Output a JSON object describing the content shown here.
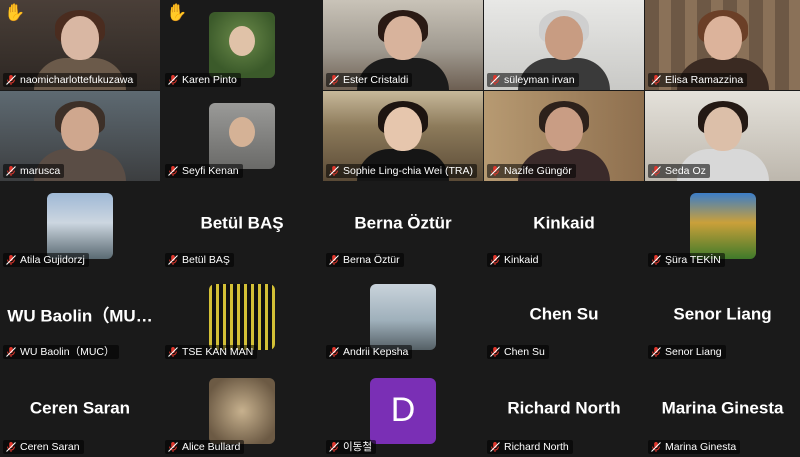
{
  "meeting": {
    "colors": {
      "background": "#1a1a1a",
      "active_speaker": "#2fd36a",
      "muted_icon": "#e0362c"
    },
    "participants": [
      {
        "name": "naomicharlottefukuzawa",
        "hand_raised": true,
        "muted": true,
        "kind": "video",
        "scene": "room-dark",
        "skin": "#d9b7a3",
        "hair": "#4a2c1f",
        "shirt": "#6b5a4a"
      },
      {
        "name": "Karen Pinto",
        "hand_raised": true,
        "muted": true,
        "kind": "photo",
        "scene": "green",
        "skin": "#e0c2a8",
        "hair": "#b89a6a",
        "shirt": "#2c3b4d"
      },
      {
        "name": "Ester Cristaldi",
        "muted": true,
        "kind": "video",
        "scene": "bright-room",
        "skin": "#d8b39c",
        "hair": "#2a1a14",
        "shirt": "#1b1b1b"
      },
      {
        "name": "süleyman irvan",
        "muted": true,
        "kind": "video",
        "scene": "white-wall",
        "skin": "#c89c82",
        "hair": "#cfcfcf",
        "shirt": "#3a3a3a"
      },
      {
        "name": "Elisa Ramazzina",
        "muted": true,
        "kind": "video",
        "scene": "bookshelf",
        "skin": "#dcb39b",
        "hair": "#6b3f27",
        "shirt": "#3a2a22"
      },
      {
        "name": "marusca",
        "muted": true,
        "kind": "video",
        "scene": "room-blue",
        "skin": "#cfa78e",
        "hair": "#3d3028",
        "shirt": "#5a4d45"
      },
      {
        "name": "Seyfi Kenan",
        "muted": true,
        "kind": "photo",
        "scene": "gray",
        "skin": "#d5b296",
        "hair": "#6a4a30",
        "shirt": "#1f2430"
      },
      {
        "name": "Sophie Ling-chia Wei (TRA)",
        "muted": true,
        "active": true,
        "kind": "video",
        "scene": "church",
        "skin": "#e6c6ad",
        "hair": "#1d1410",
        "shirt": "#151515"
      },
      {
        "name": "Nazife Güngör",
        "muted": true,
        "kind": "video",
        "scene": "office-flag",
        "skin": "#c99d84",
        "hair": "#2d211b",
        "shirt": "#3a2a2a"
      },
      {
        "name": "Seda Oz",
        "muted": true,
        "kind": "video",
        "scene": "light-wall",
        "skin": "#dcbfa9",
        "hair": "#241914",
        "shirt": "#d8d8d8"
      },
      {
        "name": "Atila Gujidorzj",
        "muted": true,
        "kind": "photo",
        "scene": "mountain"
      },
      {
        "name": "Betül BAŞ",
        "muted": true,
        "kind": "name"
      },
      {
        "name": "Berna Öztür",
        "muted": true,
        "kind": "name"
      },
      {
        "name": "Kinkaid",
        "muted": true,
        "kind": "name"
      },
      {
        "name": "Şüra TEKİN",
        "muted": true,
        "kind": "photo",
        "scene": "forest"
      },
      {
        "name": "WU Baolin（MU…",
        "label": "WU Baolin（MUC）",
        "muted": true,
        "kind": "name"
      },
      {
        "name": "TSE KAN MAN",
        "muted": true,
        "kind": "photo",
        "scene": "yellow-text"
      },
      {
        "name": "Andrii Kepsha",
        "muted": true,
        "kind": "photo",
        "scene": "harbor"
      },
      {
        "name": "Chen Su",
        "muted": true,
        "kind": "name"
      },
      {
        "name": "Senor Liang",
        "muted": true,
        "kind": "name"
      },
      {
        "name": "Ceren Saran",
        "muted": true,
        "kind": "name"
      },
      {
        "name": "Alice Bullard",
        "muted": true,
        "kind": "photo",
        "scene": "owl"
      },
      {
        "name": "이동철",
        "muted": true,
        "kind": "initial",
        "initial": "D"
      },
      {
        "name": "Richard North",
        "muted": true,
        "kind": "name"
      },
      {
        "name": "Marina Ginesta",
        "muted": true,
        "kind": "name"
      }
    ],
    "icons": {
      "mute": "mic-muted-icon",
      "hand": "raised-hand-icon"
    }
  }
}
